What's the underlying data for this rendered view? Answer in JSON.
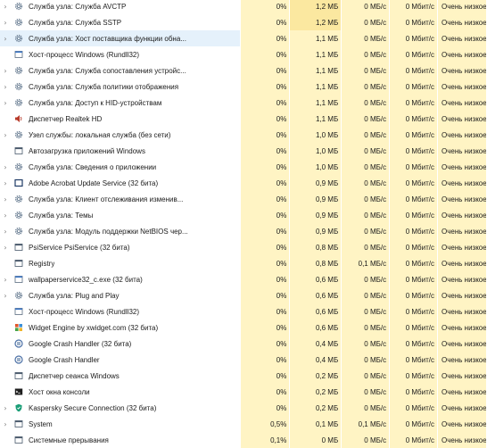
{
  "colors": {
    "cell_bg": "#fff4c4",
    "selected_row_bg": "#e5f1fb"
  },
  "rows": [
    {
      "name": "Служба узла: Служба AVCTP",
      "icon": "gear-icon",
      "exp": true,
      "cpu": "0%",
      "mem": "1,2 МБ",
      "disk": "0 МБ/с",
      "net": "0 Мбит/с",
      "power": "Очень низкое"
    },
    {
      "name": "Служба узла: Служба SSTP",
      "icon": "gear-icon",
      "exp": true,
      "cpu": "0%",
      "mem": "1,2 МБ",
      "disk": "0 МБ/с",
      "net": "0 Мбит/с",
      "power": "Очень низкое"
    },
    {
      "name": "Служба узла: Хост поставщика функции обна...",
      "icon": "gear-icon",
      "exp": true,
      "cpu": "0%",
      "mem": "1,1 МБ",
      "disk": "0 МБ/с",
      "net": "0 Мбит/с",
      "power": "Очень низкое"
    },
    {
      "name": "Хост-процесс Windows (Rundll32)",
      "icon": "window-icon",
      "exp": false,
      "cpu": "0%",
      "mem": "1,1 МБ",
      "disk": "0 МБ/с",
      "net": "0 Мбит/с",
      "power": "Очень низкое"
    },
    {
      "name": "Служба узла: Служба сопоставления устройс...",
      "icon": "gear-icon",
      "exp": true,
      "cpu": "0%",
      "mem": "1,1 МБ",
      "disk": "0 МБ/с",
      "net": "0 Мбит/с",
      "power": "Очень низкое"
    },
    {
      "name": "Служба узла: Служба политики отображения",
      "icon": "gear-icon",
      "exp": true,
      "cpu": "0%",
      "mem": "1,1 МБ",
      "disk": "0 МБ/с",
      "net": "0 Мбит/с",
      "power": "Очень низкое"
    },
    {
      "name": "Служба узла: Доступ к HID-устройствам",
      "icon": "gear-icon",
      "exp": true,
      "cpu": "0%",
      "mem": "1,1 МБ",
      "disk": "0 МБ/с",
      "net": "0 Мбит/с",
      "power": "Очень низкое"
    },
    {
      "name": "Диспетчер Realtek HD",
      "icon": "speaker-icon",
      "exp": false,
      "cpu": "0%",
      "mem": "1,1 МБ",
      "disk": "0 МБ/с",
      "net": "0 Мбит/с",
      "power": "Очень низкое"
    },
    {
      "name": "Узел службы: локальная служба (без сети)",
      "icon": "gear-icon",
      "exp": true,
      "cpu": "0%",
      "mem": "1,0 МБ",
      "disk": "0 МБ/с",
      "net": "0 Мбит/с",
      "power": "Очень низкое"
    },
    {
      "name": "Автозагрузка приложений Windows",
      "icon": "app-icon",
      "exp": false,
      "cpu": "0%",
      "mem": "1,0 МБ",
      "disk": "0 МБ/с",
      "net": "0 Мбит/с",
      "power": "Очень низкое"
    },
    {
      "name": "Служба узла: Сведения о приложении",
      "icon": "gear-icon",
      "exp": true,
      "cpu": "0%",
      "mem": "1,0 МБ",
      "disk": "0 МБ/с",
      "net": "0 Мбит/с",
      "power": "Очень низкое"
    },
    {
      "name": "Adobe Acrobat Update Service (32 бита)",
      "icon": "frame-icon",
      "exp": true,
      "cpu": "0%",
      "mem": "0,9 МБ",
      "disk": "0 МБ/с",
      "net": "0 Мбит/с",
      "power": "Очень низкое"
    },
    {
      "name": "Служба узла: Клиент отслеживания изменив...",
      "icon": "gear-icon",
      "exp": true,
      "cpu": "0%",
      "mem": "0,9 МБ",
      "disk": "0 МБ/с",
      "net": "0 Мбит/с",
      "power": "Очень низкое"
    },
    {
      "name": "Служба узла: Темы",
      "icon": "gear-icon",
      "exp": true,
      "cpu": "0%",
      "mem": "0,9 МБ",
      "disk": "0 МБ/с",
      "net": "0 Мбит/с",
      "power": "Очень низкое"
    },
    {
      "name": "Служба узла: Модуль поддержки NetBIOS чер...",
      "icon": "gear-icon",
      "exp": true,
      "cpu": "0%",
      "mem": "0,9 МБ",
      "disk": "0 МБ/с",
      "net": "0 Мбит/с",
      "power": "Очень низкое"
    },
    {
      "name": "PsiService PsiService (32 бита)",
      "icon": "app-icon",
      "exp": true,
      "cpu": "0%",
      "mem": "0,8 МБ",
      "disk": "0 МБ/с",
      "net": "0 Мбит/с",
      "power": "Очень низкое"
    },
    {
      "name": "Registry",
      "icon": "app-icon",
      "exp": false,
      "cpu": "0%",
      "mem": "0,8 МБ",
      "disk": "0,1 МБ/с",
      "net": "0 Мбит/с",
      "power": "Очень низкое"
    },
    {
      "name": "wallpaperservice32_c.exe (32 бита)",
      "icon": "window-icon",
      "exp": true,
      "cpu": "0%",
      "mem": "0,6 МБ",
      "disk": "0 МБ/с",
      "net": "0 Мбит/с",
      "power": "Очень низкое"
    },
    {
      "name": "Служба узла: Plug and Play",
      "icon": "gear-icon",
      "exp": true,
      "cpu": "0%",
      "mem": "0,6 МБ",
      "disk": "0 МБ/с",
      "net": "0 Мбит/с",
      "power": "Очень низкое"
    },
    {
      "name": "Хост-процесс Windows (Rundll32)",
      "icon": "window-icon",
      "exp": false,
      "cpu": "0%",
      "mem": "0,6 МБ",
      "disk": "0 МБ/с",
      "net": "0 Мбит/с",
      "power": "Очень низкое"
    },
    {
      "name": "Widget Engine by xwidget.com (32 бита)",
      "icon": "widget-icon",
      "exp": false,
      "cpu": "0%",
      "mem": "0,6 МБ",
      "disk": "0 МБ/с",
      "net": "0 Мбит/с",
      "power": "Очень низкое"
    },
    {
      "name": "Google Crash Handler (32 бита)",
      "icon": "google-icon",
      "exp": false,
      "cpu": "0%",
      "mem": "0,4 МБ",
      "disk": "0 МБ/с",
      "net": "0 Мбит/с",
      "power": "Очень низкое"
    },
    {
      "name": "Google Crash Handler",
      "icon": "google-icon",
      "exp": false,
      "cpu": "0%",
      "mem": "0,4 МБ",
      "disk": "0 МБ/с",
      "net": "0 Мбит/с",
      "power": "Очень низкое"
    },
    {
      "name": "Диспетчер сеанса  Windows",
      "icon": "app-icon",
      "exp": false,
      "cpu": "0%",
      "mem": "0,2 МБ",
      "disk": "0 МБ/с",
      "net": "0 Мбит/с",
      "power": "Очень низкое"
    },
    {
      "name": "Хост окна консоли",
      "icon": "console-icon",
      "exp": false,
      "cpu": "0%",
      "mem": "0,2 МБ",
      "disk": "0 МБ/с",
      "net": "0 Мбит/с",
      "power": "Очень низкое"
    },
    {
      "name": "Kaspersky Secure Connection (32 бита)",
      "icon": "kaspersky-icon",
      "exp": true,
      "cpu": "0%",
      "mem": "0,2 МБ",
      "disk": "0 МБ/с",
      "net": "0 Мбит/с",
      "power": "Очень низкое"
    },
    {
      "name": "System",
      "icon": "app-icon",
      "exp": true,
      "cpu": "0,5%",
      "mem": "0,1 МБ",
      "disk": "0,1 МБ/с",
      "net": "0 Мбит/с",
      "power": "Очень низкое"
    },
    {
      "name": "Системные прерывания",
      "icon": "app-icon",
      "exp": false,
      "cpu": "0,1%",
      "mem": "0 МБ",
      "disk": "0 МБ/с",
      "net": "0 Мбит/с",
      "power": "Очень низкое"
    }
  ]
}
